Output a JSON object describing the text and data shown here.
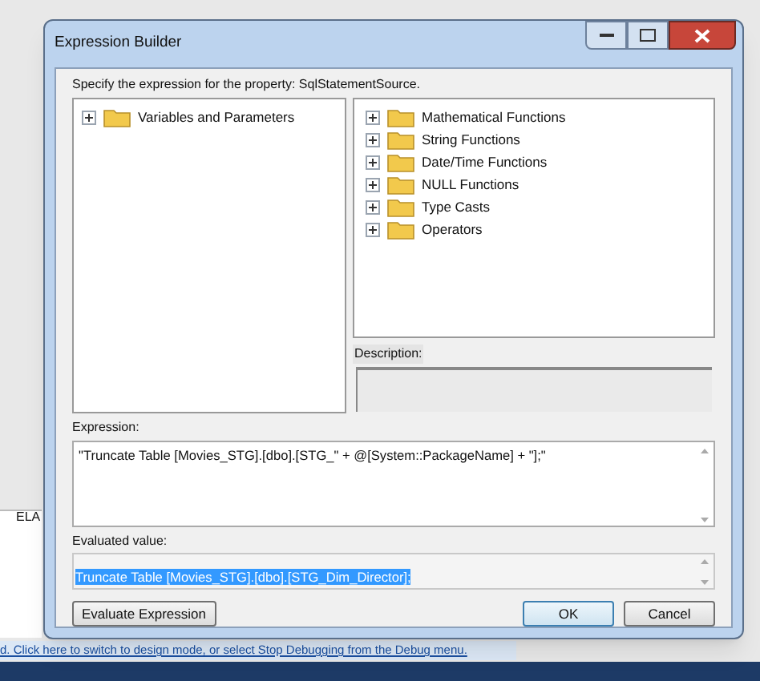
{
  "window": {
    "title": "Expression Builder"
  },
  "prompt": "Specify the expression for the property: SqlStatementSource.",
  "left_tree": [
    {
      "label": "Variables and Parameters",
      "expanded": false
    }
  ],
  "right_tree": [
    {
      "label": "Mathematical Functions",
      "expanded": false
    },
    {
      "label": "String Functions",
      "expanded": false
    },
    {
      "label": "Date/Time Functions",
      "expanded": false
    },
    {
      "label": "NULL Functions",
      "expanded": false
    },
    {
      "label": "Type Casts",
      "expanded": false
    },
    {
      "label": "Operators",
      "expanded": false
    }
  ],
  "description": {
    "label": "Description:"
  },
  "expression": {
    "label": "Expression:",
    "value": "\"Truncate Table [Movies_STG].[dbo].[STG_\" +  @[System::PackageName] + \"];\""
  },
  "evaluated": {
    "label": "Evaluated value:",
    "value": "Truncate Table [Movies_STG].[dbo].[STG_Dim_Director];",
    "selected": true
  },
  "buttons": {
    "evaluate": "Evaluate Expression",
    "ok": "OK",
    "cancel": "Cancel"
  },
  "background": {
    "item": "ELA",
    "info_bar": "d. Click here to switch to design mode, or select Stop Debugging from the Debug menu."
  }
}
